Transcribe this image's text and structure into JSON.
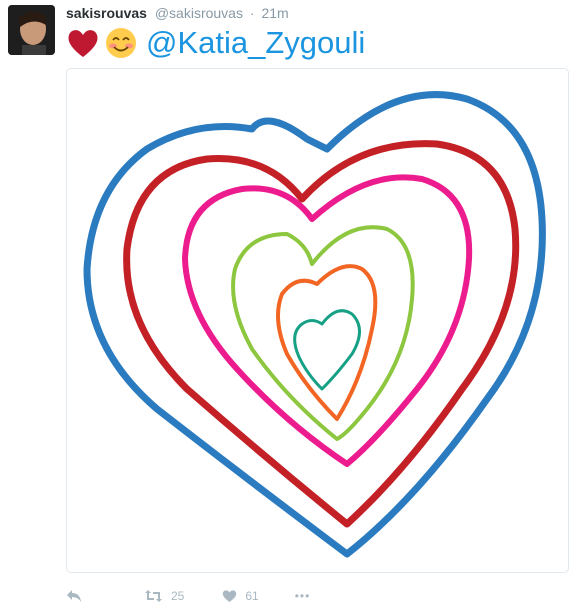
{
  "tweet": {
    "author_name": "sakisrouvas",
    "handle": "@sakisrouvas",
    "separator": "·",
    "time": "21m",
    "text_emojis": [
      "red-heart",
      "smiling-face-with-smiling-eyes"
    ],
    "mention": "@Katia_Zygouli"
  },
  "media": {
    "description_icon": "concentric-hearts-drawing",
    "heart_colors": [
      "#2b7bc0",
      "#c42127",
      "#ec1c8e",
      "#8dc63f",
      "#f26522",
      "#16a085"
    ]
  },
  "actions": {
    "retweet_count": "25",
    "like_count": "61",
    "more_label": "•••"
  },
  "colors": {
    "link": "#1b95e0",
    "muted": "#8899a6",
    "action": "#aab8c2"
  }
}
